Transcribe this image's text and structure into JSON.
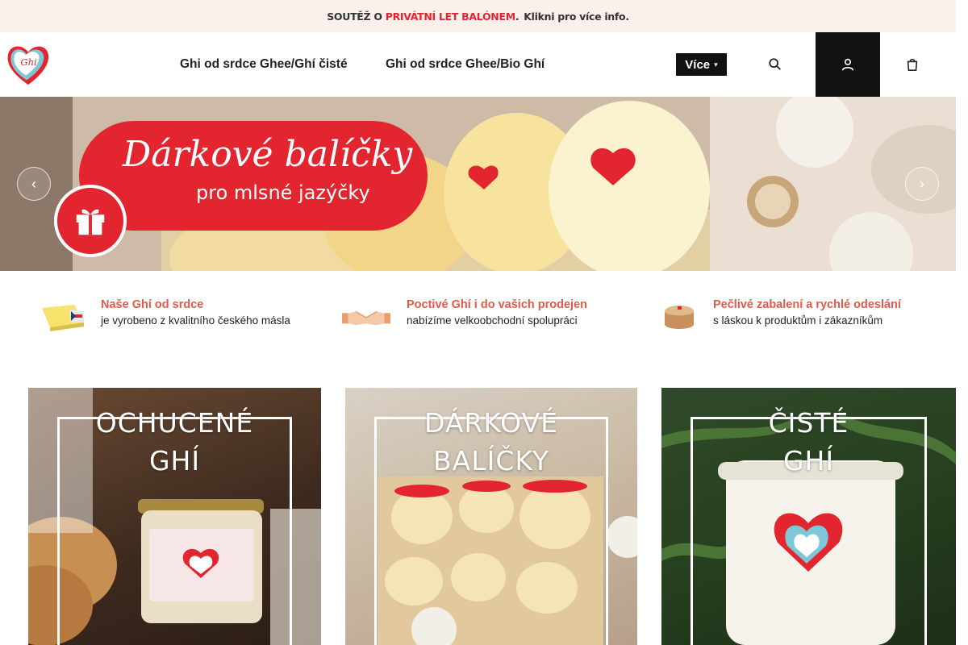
{
  "promo": {
    "prefix": "SOUTĚŽ O",
    "highlight": "PRIVÁTNÍ LET BALÓNEM",
    "suffix": ".",
    "cta": "Klikni pro více info."
  },
  "header": {
    "logo_alt": "Ghí od srdce",
    "nav": [
      {
        "label": "Ghi od srdce Ghee/Ghí čisté"
      },
      {
        "label": "Ghi od srdce Ghee/Bio Ghí"
      }
    ],
    "more_label": "Více",
    "icons": [
      "search-icon",
      "user-icon",
      "cart-icon"
    ]
  },
  "hero": {
    "title": "Dárkové balíčky",
    "subtitle": "pro mlsné jazýčky",
    "brand_color": "#e2252f"
  },
  "features": [
    {
      "icon": "butter-icon",
      "title": "Naše Ghí od srdce",
      "text": "je vyrobeno z kvalitního českého másla"
    },
    {
      "icon": "handshake-icon",
      "title": "Poctivé Ghí i do vašich prodejen",
      "text": "nabízíme velkoobchodní spolupráci"
    },
    {
      "icon": "package-icon",
      "title": "Pečlivé zabalení a rychlé odeslání",
      "text": "s láskou k produktům i zákazníkům"
    }
  ],
  "categories": [
    {
      "line1": "OCHUCENÉ",
      "line2": "GHÍ"
    },
    {
      "line1": "DÁRKOVÉ",
      "line2": "BALÍČKY"
    },
    {
      "line1": "ČISTÉ",
      "line2": "GHÍ"
    }
  ],
  "colors": {
    "accent": "#e2252f",
    "feature_title": "#e25a47",
    "promo_bg": "#fbf1ec"
  }
}
